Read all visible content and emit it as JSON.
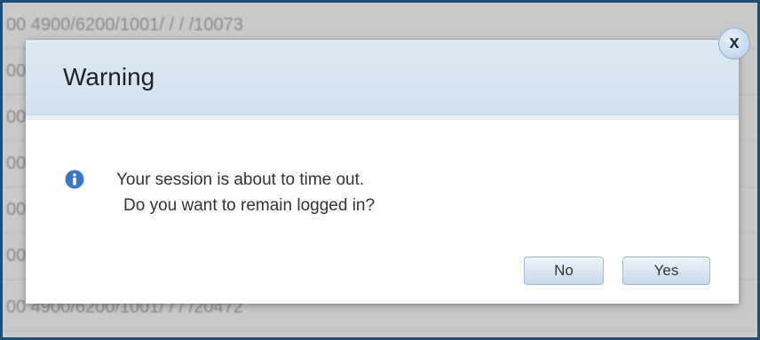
{
  "background": {
    "rows": [
      "00 4900/6200/1001/ / / /10073",
      "00",
      "00",
      "00",
      "00",
      "00",
      "00 4900/6200/1001/ / / /20472"
    ]
  },
  "dialog": {
    "title": "Warning",
    "close_label": "x",
    "message_line1": "Your session is about to time out.",
    "message_line2": "Do you want to remain logged in?",
    "buttons": {
      "no": "No",
      "yes": "Yes"
    },
    "icon": "info-icon"
  },
  "colors": {
    "frame_border": "#1f4d73",
    "header_bg": "#d2e1ef",
    "info_icon": "#3a78c4"
  }
}
